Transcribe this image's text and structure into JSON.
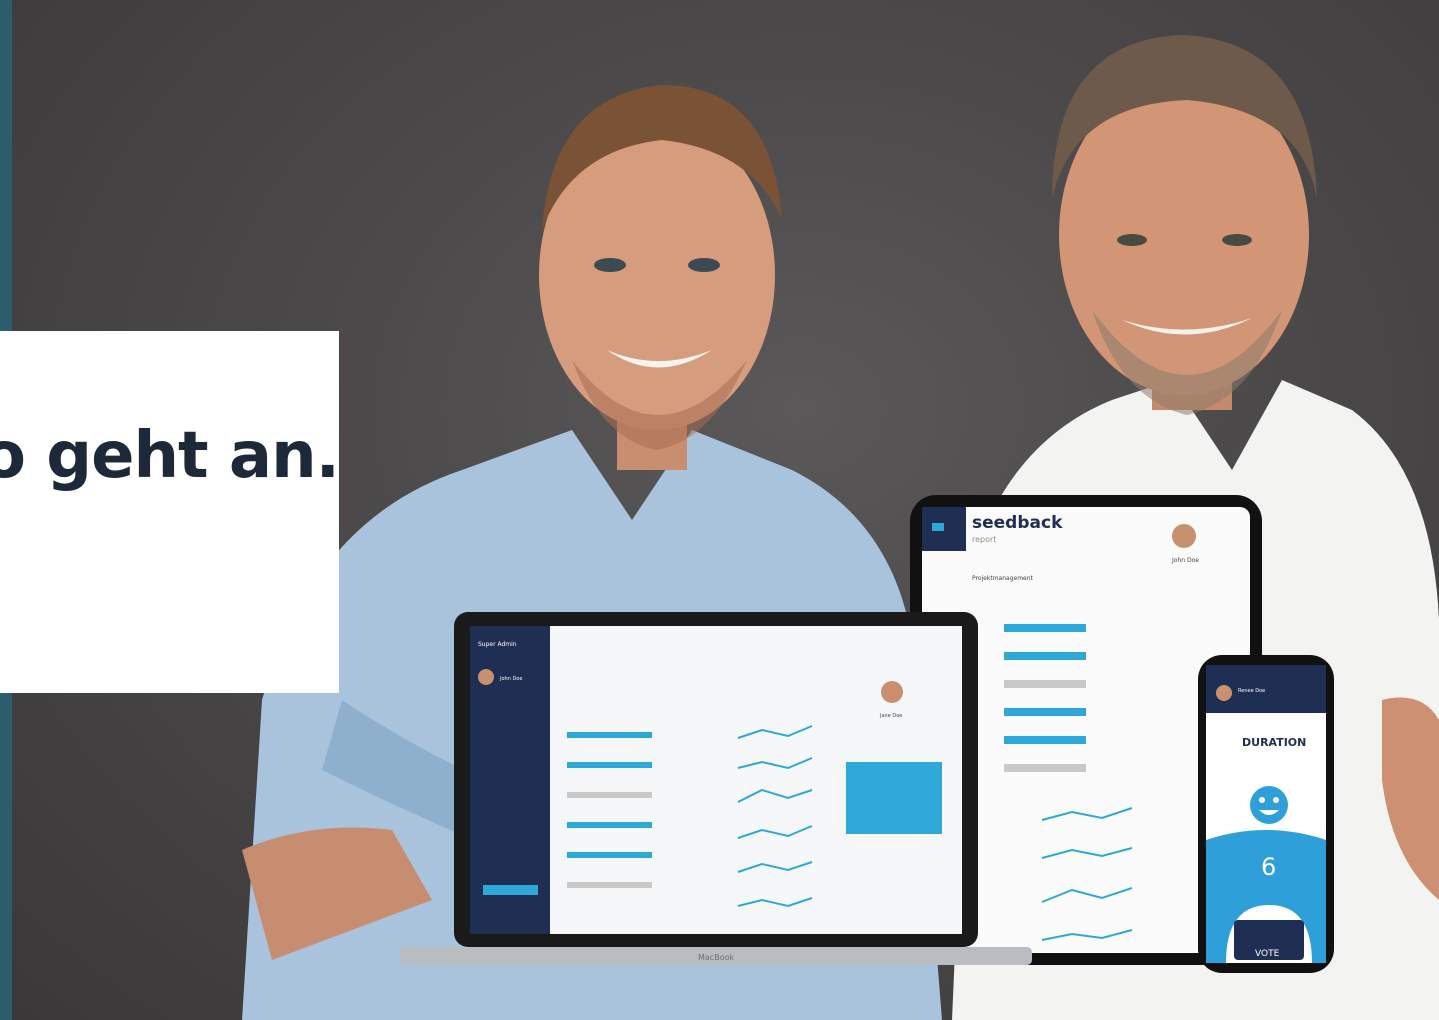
{
  "callout": {
    "text": "o geht an..."
  },
  "tablet": {
    "brand": "seedback",
    "sub": "report",
    "person": "John Doe",
    "section": "Projektmanagement"
  },
  "laptop": {
    "brand": "Super Admin",
    "person": "John Doe",
    "person2": "Jane Doe",
    "label": "MacBook"
  },
  "phone": {
    "person": "Renee Doe",
    "heading": "DURATION",
    "score": "6",
    "button": "VOTE",
    "accent": "#2e9fd8"
  },
  "colors": {
    "background": "#4a4849",
    "frame": "#2b5d6c",
    "navy": "#1e2f53",
    "accent": "#2ea8d8"
  }
}
